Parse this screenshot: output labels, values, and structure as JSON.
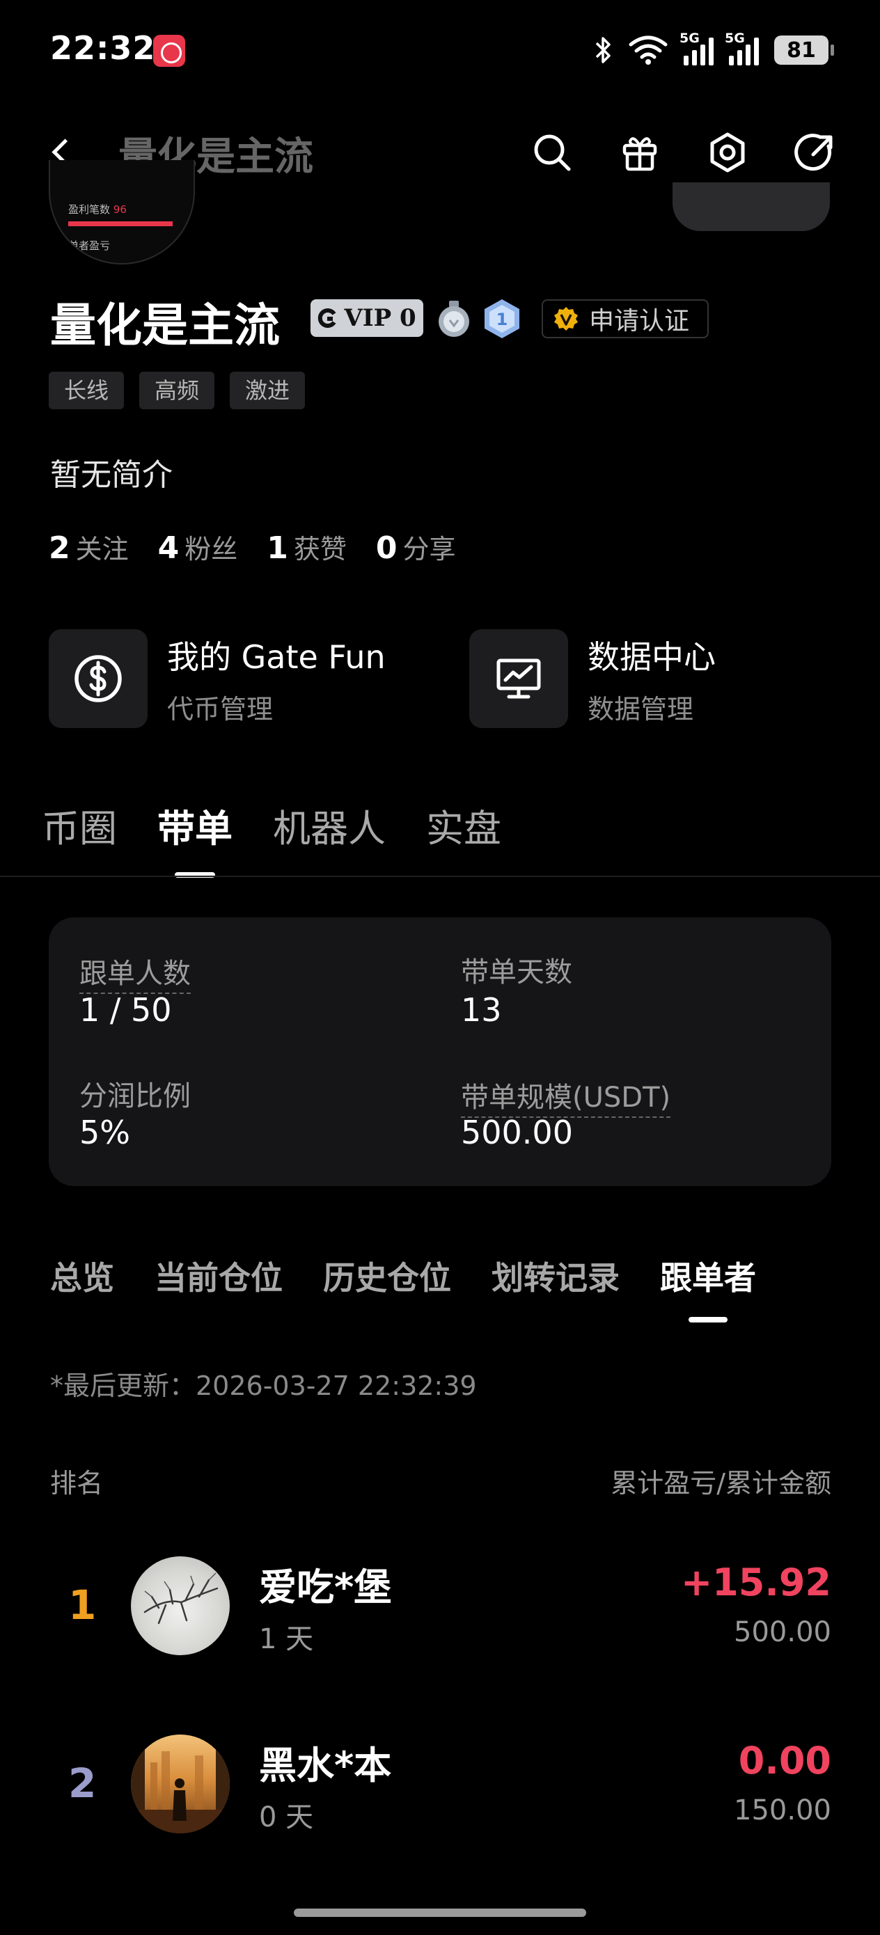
{
  "status_bar": {
    "time": "22:32",
    "signal1_label": "5G",
    "signal2_label": "5G",
    "battery": "81",
    "icons": [
      "bluetooth-icon",
      "wifi-icon",
      "signal-icon",
      "signal-icon",
      "battery-icon"
    ]
  },
  "header": {
    "title": "量化是主流",
    "icons": [
      "back-icon",
      "search-icon",
      "gift-icon",
      "settings-icon",
      "share-icon"
    ]
  },
  "avatar_card": {
    "line1": "盈利笔数",
    "line1_value": "96",
    "line2": "单者盈亏"
  },
  "profile": {
    "name": "量化是主流",
    "vip_label": "VIP 0",
    "verify_label": "申请认证",
    "tags": [
      "长线",
      "高频",
      "激进"
    ],
    "bio": "暂无简介",
    "stats": [
      {
        "value": "2",
        "label": "关注"
      },
      {
        "value": "4",
        "label": "粉丝"
      },
      {
        "value": "1",
        "label": "获赞"
      },
      {
        "value": "0",
        "label": "分享"
      }
    ]
  },
  "features": [
    {
      "title": "我的 Gate Fun",
      "subtitle": "代币管理",
      "icon": "dollar-icon"
    },
    {
      "title": "数据中心",
      "subtitle": "数据管理",
      "icon": "monitor-chart-icon"
    }
  ],
  "main_tabs": [
    {
      "label": "币圈",
      "active": false
    },
    {
      "label": "带单",
      "active": true
    },
    {
      "label": "机器人",
      "active": false
    },
    {
      "label": "实盘",
      "active": false
    }
  ],
  "summary": {
    "followers_label": "跟单人数",
    "followers_value": "1 / 50",
    "days_label": "带单天数",
    "days_value": "13",
    "share_label": "分润比例",
    "share_value": "5%",
    "scale_label": "带单规模(USDT)",
    "scale_value": "500.00"
  },
  "sub_tabs": [
    {
      "label": "总览",
      "active": false
    },
    {
      "label": "当前仓位",
      "active": false
    },
    {
      "label": "历史仓位",
      "active": false
    },
    {
      "label": "划转记录",
      "active": false
    },
    {
      "label": "跟单者",
      "active": true
    }
  ],
  "list": {
    "updated": "*最后更新：2026-03-27 22:32:39",
    "col_left": "排名",
    "col_right": "累计盈亏/累计金额",
    "rows": [
      {
        "rank": "1",
        "name": "爱吃*堡",
        "days": "1 天",
        "pnl": "+15.92",
        "amount": "500.00",
        "rank_color": "#f0a020"
      },
      {
        "rank": "2",
        "name": "黑水*本",
        "days": "0 天",
        "pnl": "0.00",
        "amount": "150.00",
        "rank_color": "#9a9ccc"
      }
    ]
  },
  "colors": {
    "background": "#000000",
    "accent_red": "#f0435f",
    "rank_gold": "#f0a020",
    "rank_silver": "#9a9ccc",
    "card_bg": "#151517"
  }
}
